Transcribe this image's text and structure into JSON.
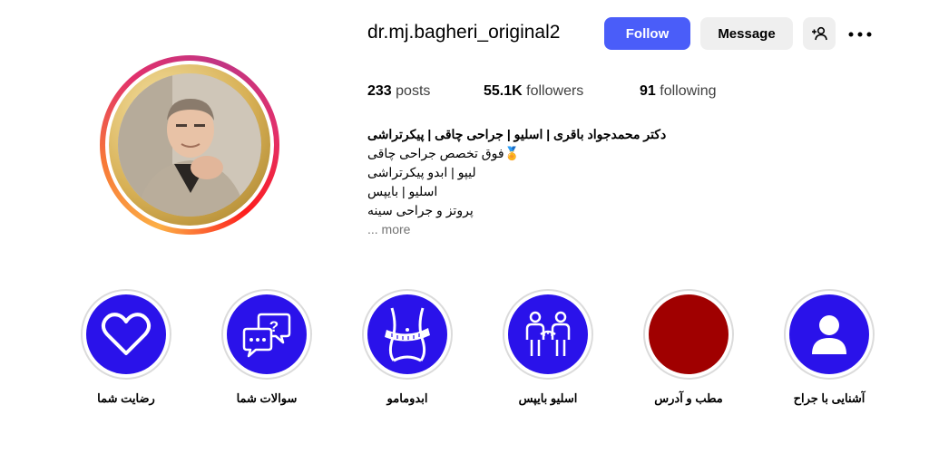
{
  "profile": {
    "username": "dr.mj.bagheri_original2",
    "follow_label": "Follow",
    "message_label": "Message",
    "stats": {
      "posts_count": "233",
      "posts_label": "posts",
      "followers_count": "55.1K",
      "followers_label": "followers",
      "following_count": "91",
      "following_label": "following"
    },
    "bio": {
      "name_line": "دکتر محمدجواد باقری | اسلیو | جراحی چاقی | پیکرتراشی",
      "lines": [
        "🏅فوق تخصص جراحی چاقی",
        "لیپو | ابدو پیکرتراشی",
        "اسلیو | بایپس",
        "پروتز و جراحی سینه"
      ],
      "more": "... more"
    }
  },
  "highlights": [
    {
      "label": "رضایت شما",
      "icon": "heart-icon",
      "color": "#2a12ea"
    },
    {
      "label": "سوالات شما",
      "icon": "chat-question-icon",
      "color": "#2a12ea"
    },
    {
      "label": "ابدومامو",
      "icon": "waist-measure-icon",
      "color": "#2a12ea"
    },
    {
      "label": "اسلیو بایپس",
      "icon": "people-measure-icon",
      "color": "#2a12ea"
    },
    {
      "label": "مطب و آدرس",
      "icon": "",
      "color": "#a00000"
    },
    {
      "label": "آشنایی با جراح",
      "icon": "user-icon",
      "color": "#2a12ea"
    }
  ],
  "colors": {
    "accent": "#4a5df9",
    "highlight_blue": "#2a12ea",
    "highlight_red": "#a00000"
  }
}
